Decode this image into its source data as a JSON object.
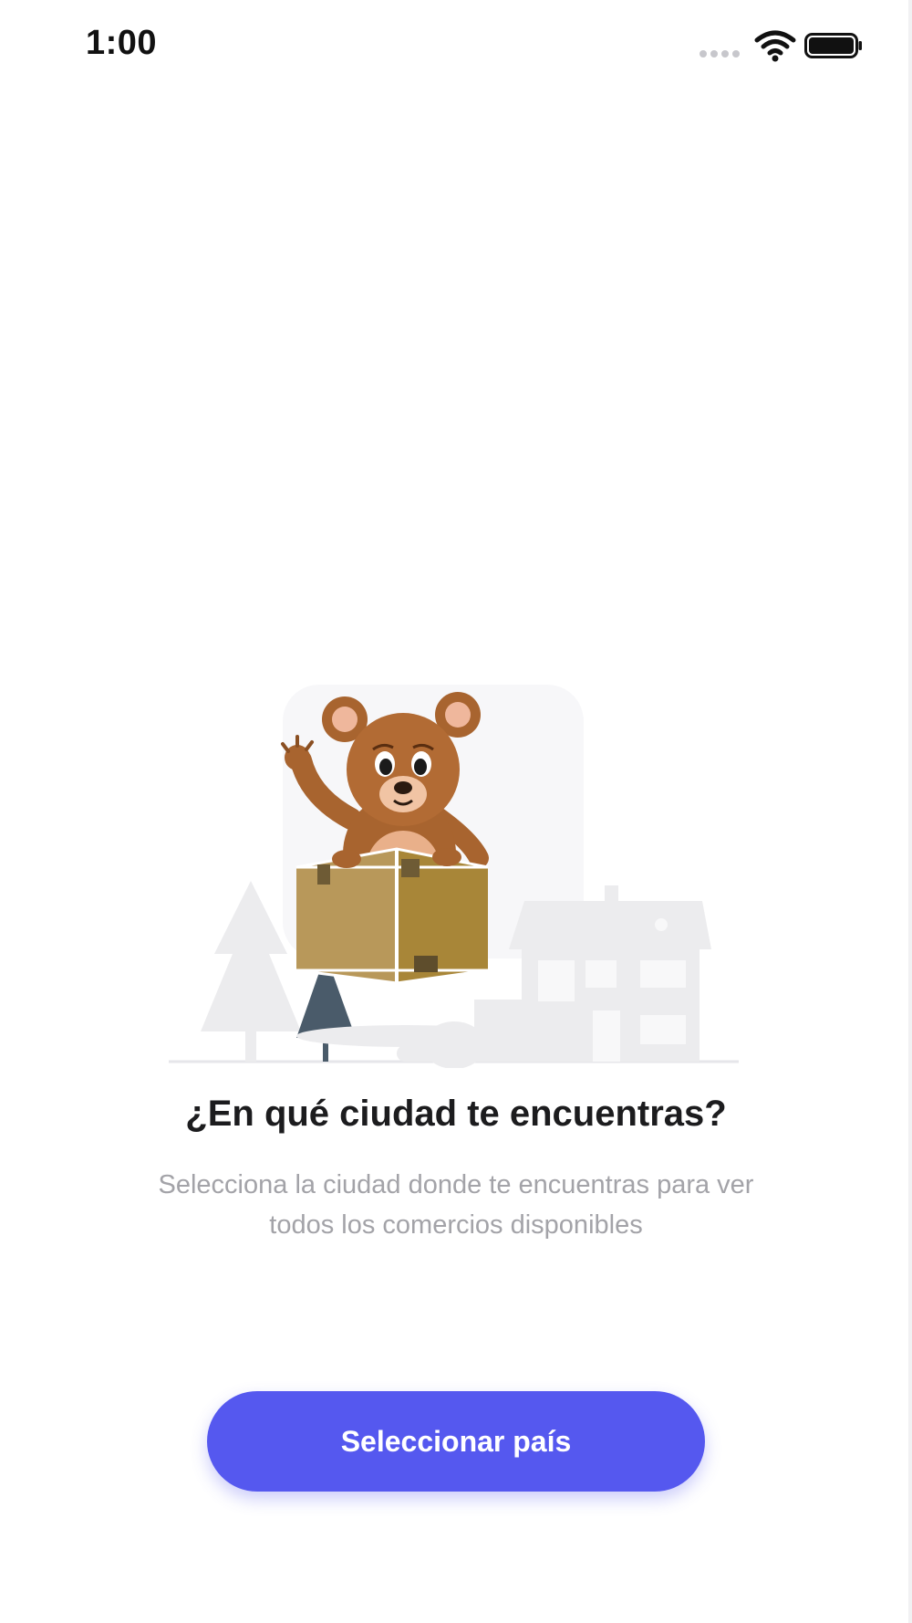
{
  "status_bar": {
    "time": "1:00",
    "icons": [
      "signal-icon",
      "wifi-icon",
      "battery-icon"
    ]
  },
  "illustration": {
    "description_icon": "teddy-bear-in-box-illustration"
  },
  "content": {
    "title": "¿En qué ciudad te encuentras?",
    "subtitle_line1": "Selecciona la ciudad donde te encuentras para ver",
    "subtitle_line2": "todos los comercios disponibles"
  },
  "actions": {
    "select_country_label": "Seleccionar país"
  },
  "colors": {
    "accent": "#5558ef",
    "title": "#1c1c1e",
    "subtitle": "#a3a3a8",
    "background": "#ffffff"
  }
}
